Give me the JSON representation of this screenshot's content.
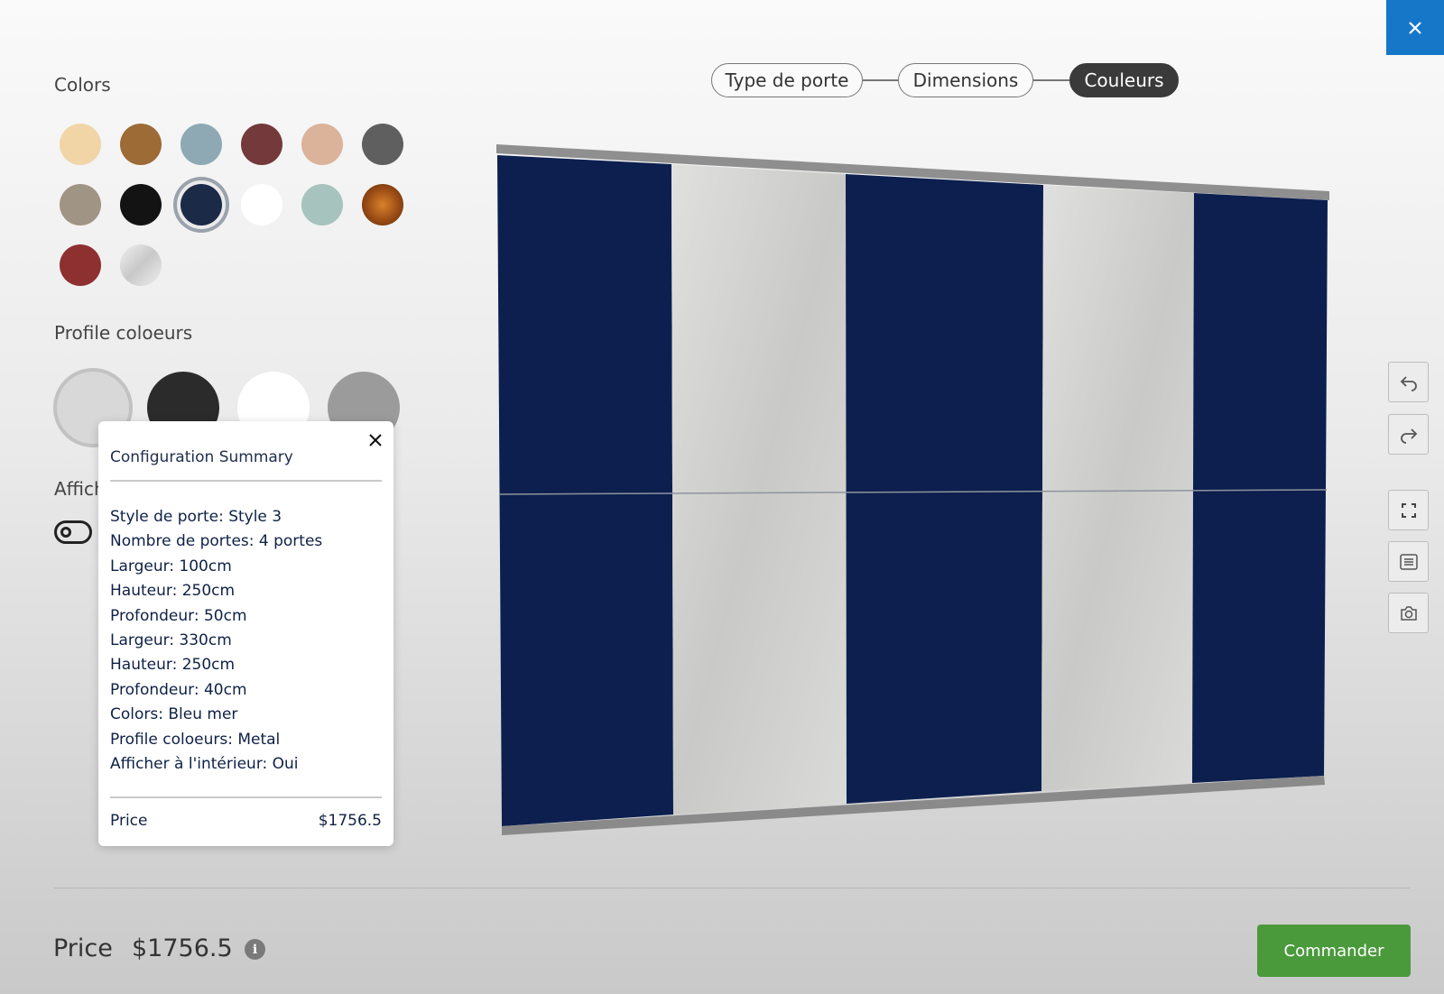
{
  "close_icon": "close-icon",
  "colors": {
    "title": "Colors",
    "swatches": [
      {
        "color": "#f1d5a7",
        "row": 0
      },
      {
        "color": "#9c6b36"
      },
      {
        "color": "#8ea9b3"
      },
      {
        "color": "#74393b"
      },
      {
        "color": "#dbb29a"
      },
      {
        "color": "#5f5f5f"
      },
      {
        "color": "#a09584"
      },
      {
        "color": "#131313"
      },
      {
        "color": "#1b2a47",
        "selected": true
      },
      {
        "color": "#ffffff"
      },
      {
        "color": "#a7c3bd"
      },
      {
        "color": "#a8561d"
      },
      {
        "color": "#8e2f30"
      },
      {
        "color": "#d9d9d9"
      }
    ]
  },
  "profile": {
    "title": "Profile coloeurs",
    "swatches": [
      {
        "color": "#d8d8d8",
        "selected": true
      },
      {
        "color": "#2b2b2b"
      },
      {
        "color": "#ffffff"
      },
      {
        "color": "#9b9b9b"
      }
    ]
  },
  "interior": {
    "label": "Afficher à l'intérieur"
  },
  "summary": {
    "title": "Configuration Summary",
    "items": [
      "Style de porte: Style 3",
      "Nombre de portes: 4 portes",
      "Largeur: 100cm",
      "Hauteur: 250cm",
      "Profondeur: 50cm",
      "Largeur: 330cm",
      "Hauteur: 250cm",
      "Profondeur: 40cm",
      "Colors: Bleu mer",
      "Profile coloeurs: Metal",
      "Afficher à l'intérieur: Oui"
    ],
    "price_label": "Price",
    "price_value": "$1756.5"
  },
  "steps": [
    {
      "label": "Type de porte"
    },
    {
      "label": "Dimensions"
    },
    {
      "label": "Couleurs",
      "active": true
    }
  ],
  "tools": [
    "undo-icon",
    "redo-icon",
    "fullscreen-icon",
    "list-icon",
    "camera-icon"
  ],
  "footer": {
    "price_label": "Price",
    "price_value": "$1756.5",
    "order_label": "Commander"
  },
  "wardrobe": {
    "navy": "#0c1f4f",
    "light": "#d3d3d1",
    "rail": "#8a8a8a"
  }
}
